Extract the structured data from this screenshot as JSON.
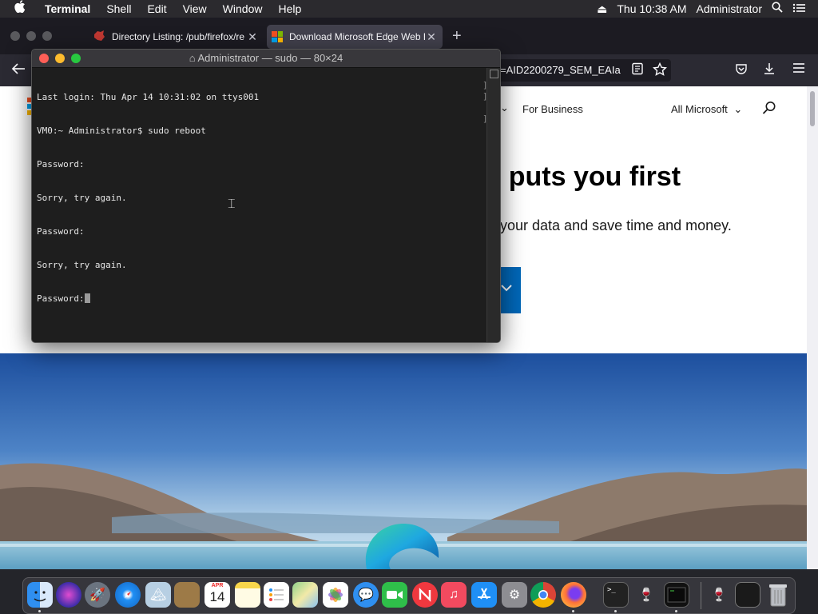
{
  "menubar": {
    "apple": "",
    "app_name": "Terminal",
    "items": [
      "Shell",
      "Edit",
      "View",
      "Window",
      "Help"
    ],
    "clock": "Thu 10:38 AM",
    "user": "Administrator"
  },
  "firefox": {
    "tabs": [
      {
        "title": "Directory Listing: /pub/firefox/re"
      },
      {
        "title": "Download Microsoft Edge Web B"
      }
    ],
    "new_tab": "+",
    "url_fragment": "=AID2200279_SEM_EAIa",
    "page": {
      "nav_business": "For Business",
      "nav_all_microsoft": "All Microsoft",
      "headline": "t puts you first",
      "subline": "t your data and save time and money."
    }
  },
  "terminal": {
    "title": "Administrator — sudo — 80×24",
    "lines": [
      "Last login: Thu Apr 14 10:31:02 on ttys001",
      "VM0:~ Administrator$ sudo reboot",
      "Password:",
      "Sorry, try again.",
      "Password:",
      "Sorry, try again.",
      "Password:"
    ]
  },
  "dock": {
    "calendar_month": "APR",
    "calendar_day": "14"
  },
  "colors": {
    "menubar": "#2b2a2e",
    "terminal_bg": "#1e1e1e",
    "ms_blue": "#0067b8",
    "close_red": "#fe5f57",
    "min_yellow": "#febc2e",
    "max_green": "#28c840"
  }
}
